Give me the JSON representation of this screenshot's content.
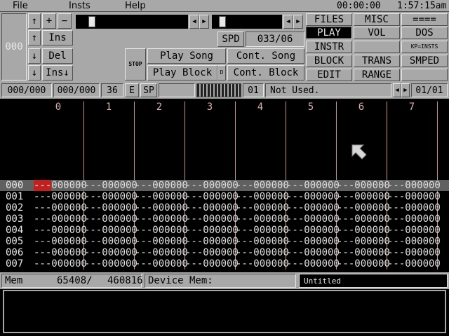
{
  "menu": {
    "file": "File",
    "insts": "Insts",
    "help": "Help"
  },
  "clock": {
    "elapsed": "00:00:00",
    "time": "1:57:15am"
  },
  "panel": {
    "row_counter": "000",
    "up_arrow": "↑",
    "down_arrow": "↓",
    "plus": "+",
    "minus": "−",
    "ins": "Ins",
    "del": "Del",
    "ins_down": "Ins↓",
    "spd_label": "SPD",
    "spd_value": "033/06",
    "stop": "STOP",
    "play_song": "Play Song",
    "play_block": "Play Block",
    "d": "D",
    "cont_song": "Cont. Song",
    "cont_block": "Cont. Block",
    "left_arrow": "◀",
    "right_arrow": "▶"
  },
  "menu_buttons": {
    "files": "FILES",
    "misc": "MISC",
    "eq": "====",
    "play": "PLAY",
    "vol": "VOL",
    "dos": "DOS",
    "instr": "INSTR",
    "kp": "KP=INSTS",
    "block": "BLOCK",
    "trans": "TRANS",
    "smped": "SMPED",
    "edit": "EDIT",
    "range": "RANGE"
  },
  "status": {
    "pos1": "000/000",
    "pos2": "000/000",
    "num": "36",
    "e": "E",
    "sp": "SP",
    "inst_num": "01",
    "inst_name": "Not Used.",
    "page": "01/01"
  },
  "tracks": [
    "0",
    "1",
    "2",
    "3",
    "4",
    "5",
    "6",
    "7"
  ],
  "rows": [
    {
      "num": "000",
      "cell": "---000000"
    },
    {
      "num": "001",
      "cell": "---000000"
    },
    {
      "num": "002",
      "cell": "---000000"
    },
    {
      "num": "003",
      "cell": "---000000"
    },
    {
      "num": "004",
      "cell": "---000000"
    },
    {
      "num": "005",
      "cell": "---000000"
    },
    {
      "num": "006",
      "cell": "---000000"
    },
    {
      "num": "007",
      "cell": "---000000"
    }
  ],
  "cursor_note": "---",
  "mem": {
    "label": "Mem",
    "value": "65408/",
    "total": "460816",
    "device_label": "Device Mem:",
    "song_name": "Untitled"
  },
  "colors": {
    "panel": "#a8a8a8",
    "cursor": "#c02020",
    "track_sep": "#c89080",
    "highlight_row": "#606060"
  }
}
